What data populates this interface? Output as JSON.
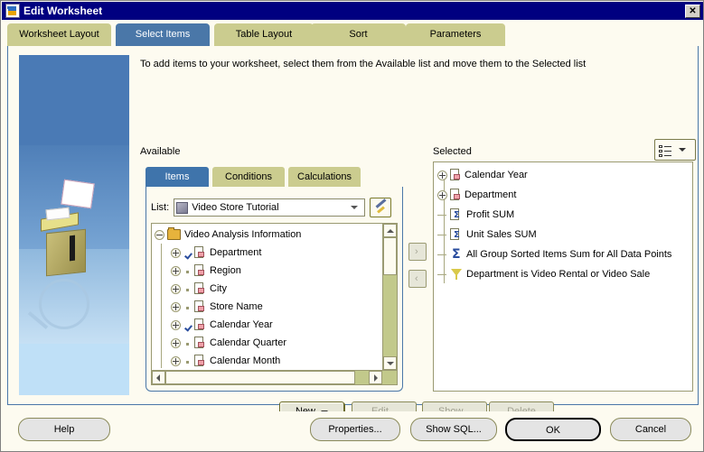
{
  "window": {
    "title": "Edit Worksheet",
    "close_label": "✕",
    "icon": "worksheet-icon"
  },
  "tabs": [
    {
      "label": "Worksheet Layout",
      "active": false
    },
    {
      "label": "Select Items",
      "active": true
    },
    {
      "label": "Table Layout",
      "active": false
    },
    {
      "label": "Sort",
      "active": false
    },
    {
      "label": "Parameters",
      "active": false
    }
  ],
  "description": "To add items to your worksheet, select them from the Available list and move them to the Selected list",
  "available": {
    "label": "Available",
    "subtabs": [
      {
        "label": "Items",
        "active": true
      },
      {
        "label": "Conditions",
        "active": false
      },
      {
        "label": "Calculations",
        "active": false
      }
    ],
    "list": {
      "label": "List:",
      "value": "Video Store Tutorial",
      "icon": "database-icon",
      "tool_button_icon": "wand-icon"
    },
    "tree": [
      {
        "label": "Video Analysis Information",
        "icon": "folder-icon",
        "expander": "minus",
        "depth": 0,
        "checked": "none"
      },
      {
        "label": "Department",
        "icon": "page-icon",
        "expander": "plus",
        "depth": 1,
        "checked": "yes"
      },
      {
        "label": "Region",
        "icon": "page-icon",
        "expander": "plus",
        "depth": 1,
        "checked": "no"
      },
      {
        "label": "City",
        "icon": "page-icon",
        "expander": "plus",
        "depth": 1,
        "checked": "no"
      },
      {
        "label": "Store Name",
        "icon": "page-icon",
        "expander": "plus",
        "depth": 1,
        "checked": "no"
      },
      {
        "label": "Calendar Year",
        "icon": "page-icon",
        "expander": "plus",
        "depth": 1,
        "checked": "yes"
      },
      {
        "label": "Calendar Quarter",
        "icon": "page-icon",
        "expander": "plus",
        "depth": 1,
        "checked": "no"
      },
      {
        "label": "Calendar Month",
        "icon": "page-icon",
        "expander": "plus",
        "depth": 1,
        "checked": "no"
      }
    ]
  },
  "transfer": {
    "right_label": "›",
    "left_label": "‹"
  },
  "selected": {
    "label": "Selected",
    "view_button_icon": "list-view-icon",
    "items": [
      {
        "label": "Calendar Year",
        "icon": "page-icon",
        "expander": "plus"
      },
      {
        "label": "Department",
        "icon": "page-icon",
        "expander": "plus"
      },
      {
        "label": "Profit SUM",
        "icon": "sigma-icon",
        "expander": "leaf"
      },
      {
        "label": "Unit Sales SUM",
        "icon": "sigma-icon",
        "expander": "leaf"
      },
      {
        "label": "All Group Sorted Items Sum for All Data Points",
        "icon": "group-sort-icon",
        "expander": "leaf"
      },
      {
        "label": "Department is Video Rental or Video Sale",
        "icon": "funnel-icon",
        "expander": "leaf"
      }
    ]
  },
  "item_actions": {
    "new": "New",
    "edit": "Edit...",
    "show": "Show...",
    "delete": "Delete"
  },
  "dialog_buttons": {
    "help": "Help",
    "properties": "Properties...",
    "show_sql": "Show SQL...",
    "ok": "OK",
    "cancel": "Cancel"
  },
  "colors": {
    "titlebar": "#000080",
    "active_tab": "#4a77a8",
    "inactive_tab": "#cbcc8f",
    "dialog_bg": "#fdfbf0",
    "panel_border": "#4a77a8"
  }
}
